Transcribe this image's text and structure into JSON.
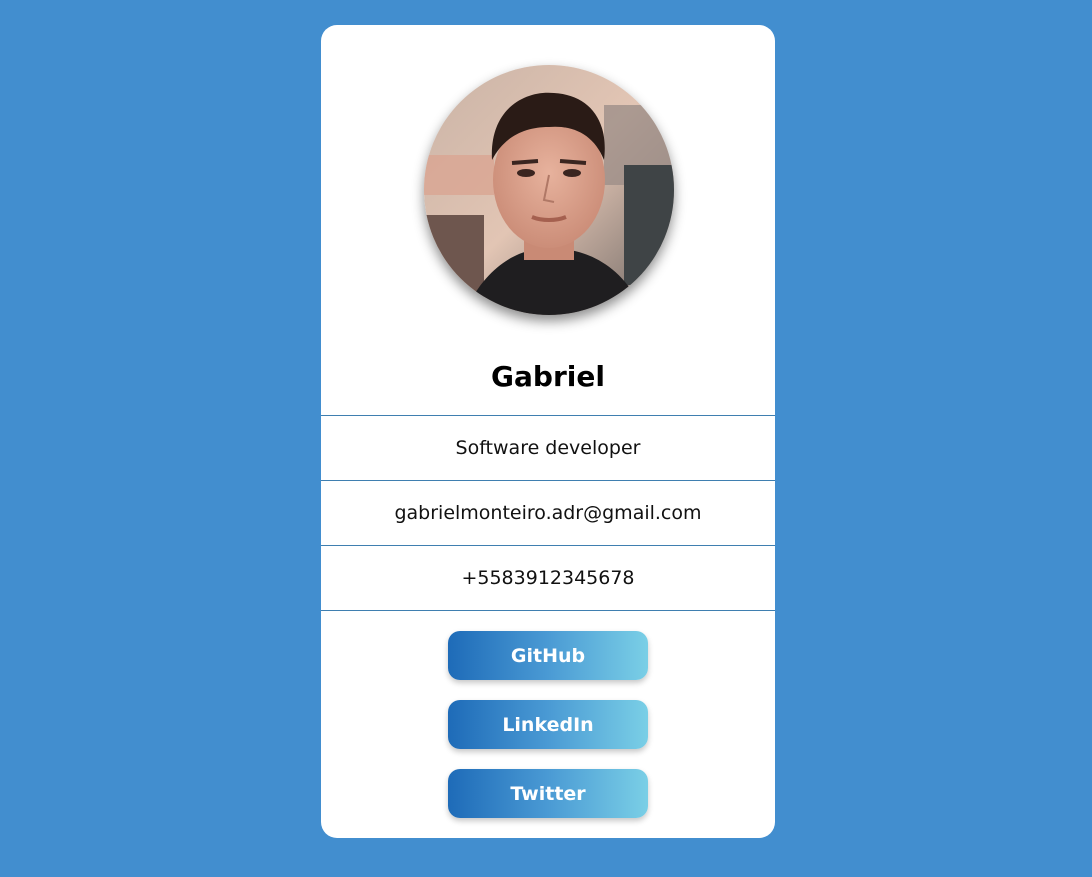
{
  "profile": {
    "name": "Gabriel",
    "role": "Software developer",
    "email": "gabrielmonteiro.adr@gmail.com",
    "phone": "+5583912345678",
    "avatar_alt": "profile photo"
  },
  "links": {
    "github_label": "GitHub",
    "linkedin_label": "LinkedIn",
    "twitter_label": "Twitter"
  },
  "colors": {
    "page_background": "#428ecf",
    "card_background": "#ffffff",
    "divider": "#3f7fb0",
    "button_gradient_start": "#1e6bb8",
    "button_gradient_end": "#7acfe6",
    "button_text": "#ffffff"
  }
}
